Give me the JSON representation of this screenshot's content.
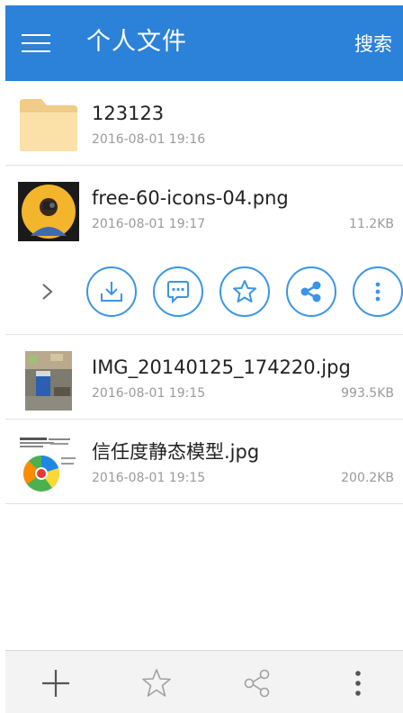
{
  "header": {
    "title": "个人文件",
    "search_label": "搜索",
    "menu_icon": "hamburger-menu-icon",
    "background_color": "#2b82d8"
  },
  "files": [
    {
      "name": "123123",
      "date": "2016-08-01 19:16",
      "size": "",
      "icon": "folder-icon",
      "type": "folder"
    },
    {
      "name": "free-60-icons-04.png",
      "date": "2016-08-01 19:17",
      "size": "11.2KB",
      "icon": "image-thumbnail",
      "type": "image"
    },
    {
      "name": "IMG_20140125_174220.jpg",
      "date": "2016-08-01 19:15",
      "size": "993.5KB",
      "icon": "photo-thumbnail",
      "type": "image"
    },
    {
      "name": "信任度静态模型.jpg",
      "date": "2016-08-01 19:15",
      "size": "200.2KB",
      "icon": "diagram-thumbnail",
      "type": "image"
    }
  ],
  "action_row": {
    "collapse_icon": "chevron-right-icon",
    "actions": [
      {
        "name": "download",
        "icon": "download-icon"
      },
      {
        "name": "comment",
        "icon": "comment-icon"
      },
      {
        "name": "favorite",
        "icon": "star-icon"
      },
      {
        "name": "share",
        "icon": "share-icon"
      },
      {
        "name": "more",
        "icon": "more-vertical-icon"
      }
    ],
    "accent_color": "#3a95e6"
  },
  "bottom_bar": {
    "actions": [
      {
        "name": "add",
        "icon": "plus-icon"
      },
      {
        "name": "favorite",
        "icon": "star-outline-icon"
      },
      {
        "name": "share",
        "icon": "share-outline-icon"
      },
      {
        "name": "more",
        "icon": "more-vertical-icon"
      }
    ]
  }
}
